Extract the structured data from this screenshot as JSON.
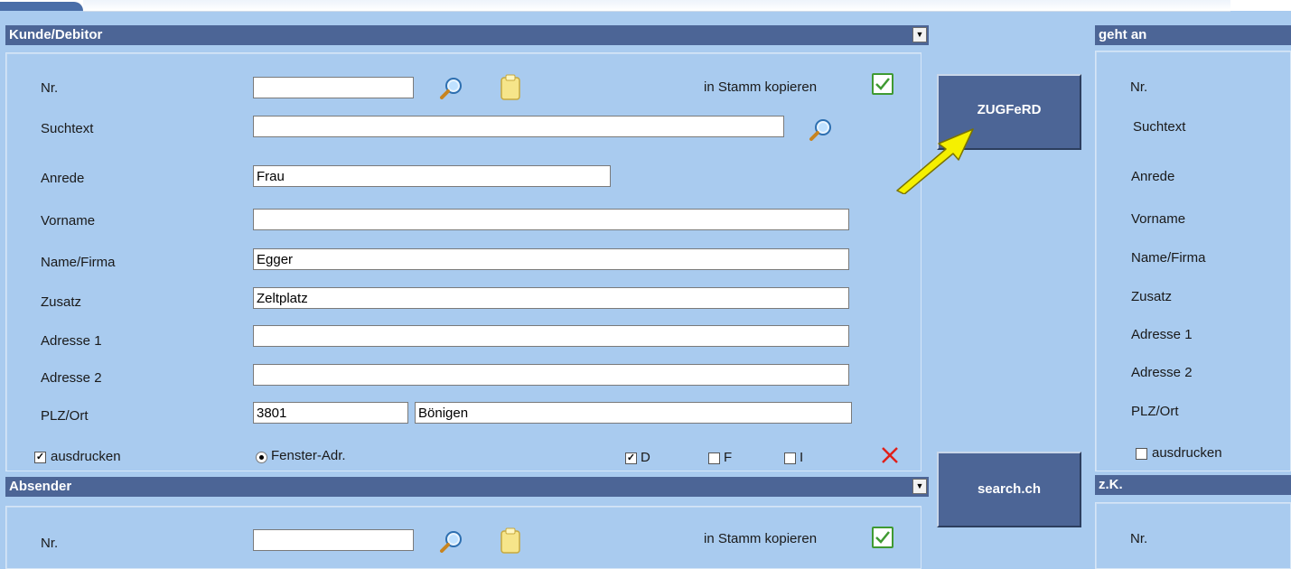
{
  "kunde": {
    "header": "Kunde/Debitor",
    "labels": {
      "nr": "Nr.",
      "suchtext": "Suchtext",
      "anrede": "Anrede",
      "vorname": "Vorname",
      "name": "Name/Firma",
      "zusatz": "Zusatz",
      "adresse1": "Adresse 1",
      "adresse2": "Adresse 2",
      "plzort": "PLZ/Ort"
    },
    "values": {
      "nr": "",
      "suchtext": "",
      "anrede": "Frau",
      "vorname": "",
      "name": "Egger",
      "zusatz": "Zeltplatz",
      "adresse1": "",
      "adresse2": "",
      "plz": "3801",
      "ort": "Bönigen"
    },
    "copy_label": "in Stamm kopieren",
    "ausdrucken": "ausdrucken",
    "fenster": "Fenster-Adr.",
    "lang_d": "D",
    "lang_f": "F",
    "lang_i": "I"
  },
  "absender": {
    "header": "Absender",
    "nr_label": "Nr.",
    "nr_value": "",
    "copy_label": "in Stamm kopieren"
  },
  "buttons": {
    "zugferd": "ZUGFeRD",
    "search": "search.ch"
  },
  "geht_an": {
    "header": "geht an",
    "labels": [
      "Nr.",
      "Suchtext",
      "Anrede",
      "Vorname",
      "Name/Firma",
      "Zusatz",
      "Adresse 1",
      "Adresse 2",
      "PLZ/Ort"
    ],
    "ausdrucken": "ausdrucken"
  },
  "zk": {
    "header": "z.K.",
    "nr_label": "Nr."
  },
  "colors": {
    "header_bg": "#4c6596",
    "panel_bg": "#a9cbef",
    "arrow": "#f5f000",
    "check_green": "#3f9a32",
    "delete_red": "#e0201a"
  },
  "icons": [
    "search-icon",
    "clipboard-icon",
    "green-check-icon",
    "red-x-icon",
    "dropdown-arrow-icon"
  ]
}
